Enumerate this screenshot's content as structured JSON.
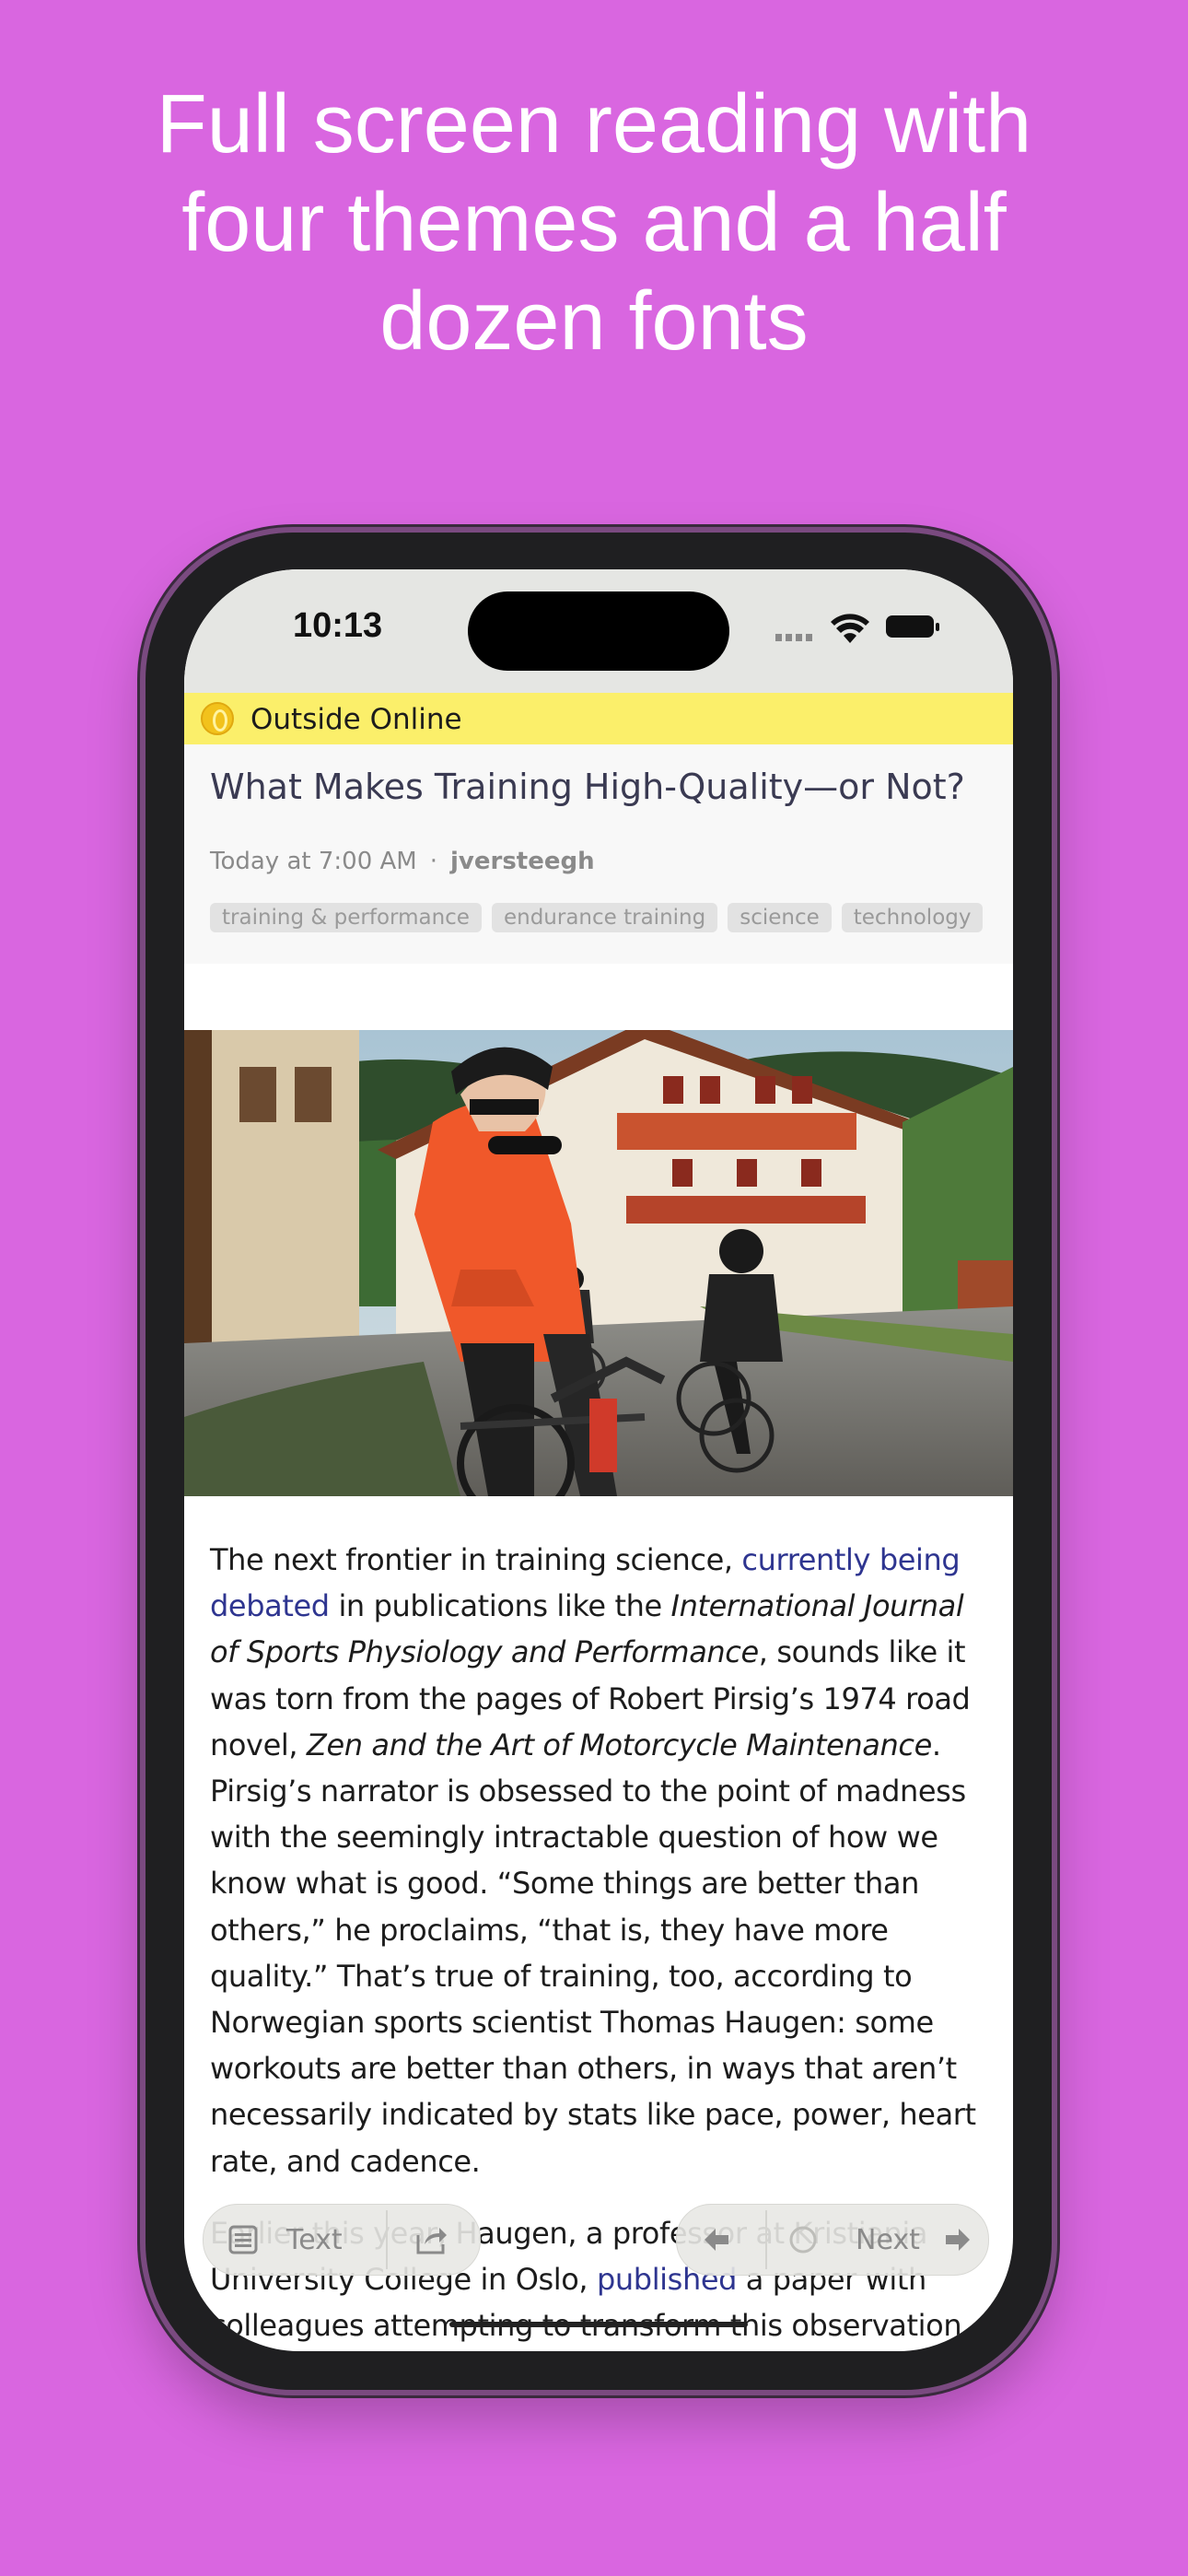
{
  "promo": {
    "headline_line1": "Full screen reading with",
    "headline_line2": "four themes and a half",
    "headline_line3": "dozen fonts"
  },
  "status_bar": {
    "time": "10:13"
  },
  "feed": {
    "name": "Outside Online",
    "icon": "feed-logo-icon"
  },
  "article": {
    "title": "What Makes Training High-Quality—or Not?",
    "date": "Today at 7:00 AM",
    "separator": "·",
    "author": "jversteegh",
    "tags": [
      "training & performance",
      "endurance training",
      "science",
      "technology"
    ],
    "p1": {
      "s1": "The next frontier in training science, ",
      "link1": "currently being debated",
      "s2": " in publications like the ",
      "em1": "International Journal of Sports Physiology and Performance",
      "s3": ", sounds like it was torn from the pages of Robert Pirsig’s 1974 road novel, ",
      "em2": "Zen and the Art of Motorcycle Maintenance",
      "s4": ". Pirsig’s narrator is obsessed to the point of madness with the seemingly intractable question of how we know what is good. “Some things are better than others,” he proclaims, “that is, they have more quality.” That’s true of training, too, according to Norwegian sports scientist Thomas Haugen: some workouts are better than others, in ways that aren’t necessarily indicated by stats like pace, power, heart rate, and cadence."
    },
    "p2": {
      "s1": "Earlier this year, Haugen, a professor at Kristiania University College in Oslo, ",
      "link1": "published",
      "s2": " a paper with colleagues attempting to transform this observation into a more concrete definition of training quality—and"
    }
  },
  "toolbar": {
    "text_label": "Text",
    "next_label": "Next",
    "icons": [
      "text-view-icon",
      "share-icon",
      "back-arrow-icon",
      "unread-circle-icon",
      "next-arrow-icon"
    ]
  },
  "colors": {
    "background": "#d966e0",
    "feed_bar": "#fbef6a",
    "link": "#2e3590",
    "title": "#3a3a52"
  }
}
